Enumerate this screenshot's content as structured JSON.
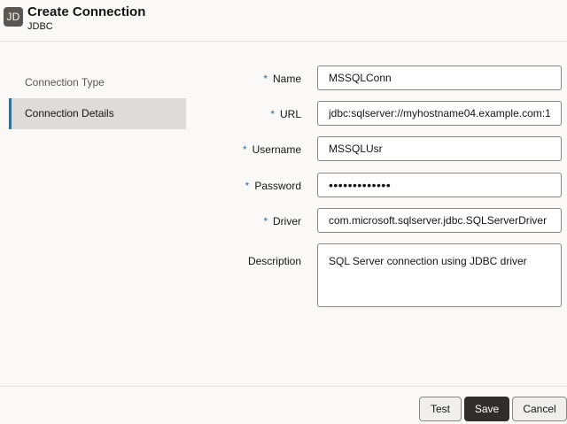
{
  "header": {
    "badge": "JD",
    "title": "Create Connection",
    "subtitle": "JDBC"
  },
  "nav": {
    "items": [
      {
        "label": "Connection Type",
        "active": false
      },
      {
        "label": "Connection Details",
        "active": true
      }
    ]
  },
  "form": {
    "required_marker": "*",
    "name": {
      "label": "Name",
      "value": "MSSQLConn"
    },
    "url": {
      "label": "URL",
      "value": "jdbc:sqlserver://myhostname04.example.com:1"
    },
    "username": {
      "label": "Username",
      "value": "MSSQLUsr"
    },
    "password": {
      "label": "Password",
      "value": "•••••••••••••"
    },
    "driver": {
      "label": "Driver",
      "value": "com.microsoft.sqlserver.jdbc.SQLServerDriver"
    },
    "description": {
      "label": "Description",
      "value": "SQL Server connection using JDBC driver"
    }
  },
  "footer": {
    "test_label": "Test",
    "save_label": "Save",
    "cancel_label": "Cancel"
  },
  "colors": {
    "accent": "#3a6e8f",
    "primary_button": "#312d2a",
    "background": "#fbf9f8",
    "nav_active": "#dedbd8"
  }
}
